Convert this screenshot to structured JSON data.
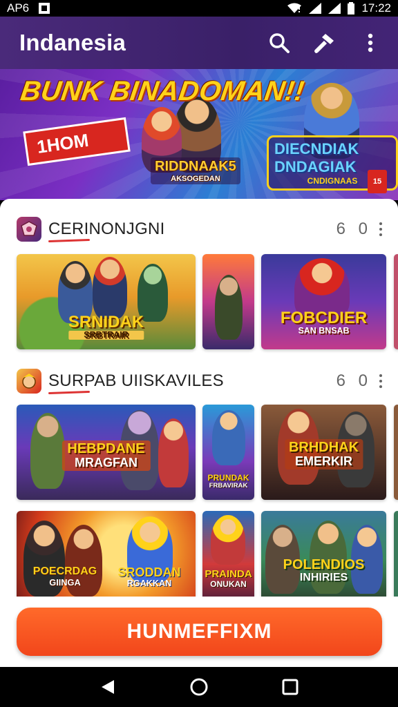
{
  "status_bar": {
    "carrier": "AP6",
    "time": "17:22"
  },
  "app_bar": {
    "title": "Indanesia",
    "actions": [
      "search-icon",
      "hammer-icon",
      "more-vert-icon"
    ]
  },
  "banner": {
    "headline": "BUNK BINADOMAN!!",
    "ribbon": "1HOM",
    "logo_left": "RIDDNAAK5",
    "logo_left_sub": "AKSOGEDAN",
    "logo_right": "DIECNDIAK DNDAGIAK",
    "logo_right_sub": "CNDIGNAAS",
    "badge": "15"
  },
  "sections": [
    {
      "title": "CERINONJGNI",
      "count": "6 0",
      "cards": [
        {
          "label": "SRNIDAK",
          "sub": "SRBTRAIR",
          "corner": ""
        },
        {
          "label": "",
          "sub": ""
        },
        {
          "label": "FOBCDIER",
          "sub": "SAN BNSAB"
        }
      ]
    },
    {
      "title": "SURPAB UIISKAVILES",
      "count": "6 0",
      "cards": [
        {
          "label": "HEBPDANE",
          "sub": "MRAGFAN"
        },
        {
          "label": "PRUNDAK",
          "sub": "FRBAVIRAK"
        },
        {
          "label": "BRHDHAK",
          "sub": "EMERKIR"
        }
      ]
    },
    {
      "title": "",
      "cards": [
        {
          "label": "POECRDAG",
          "sub": "GIINGA"
        },
        {
          "label": "SRODDAN",
          "sub": "RGAKKAN"
        },
        {
          "label": "PRAINDA",
          "sub": "ONUKAN"
        },
        {
          "label": "POLENDIOS",
          "sub": "INHIRIES"
        }
      ]
    }
  ],
  "cta_label": "HUNMEFFIXM"
}
